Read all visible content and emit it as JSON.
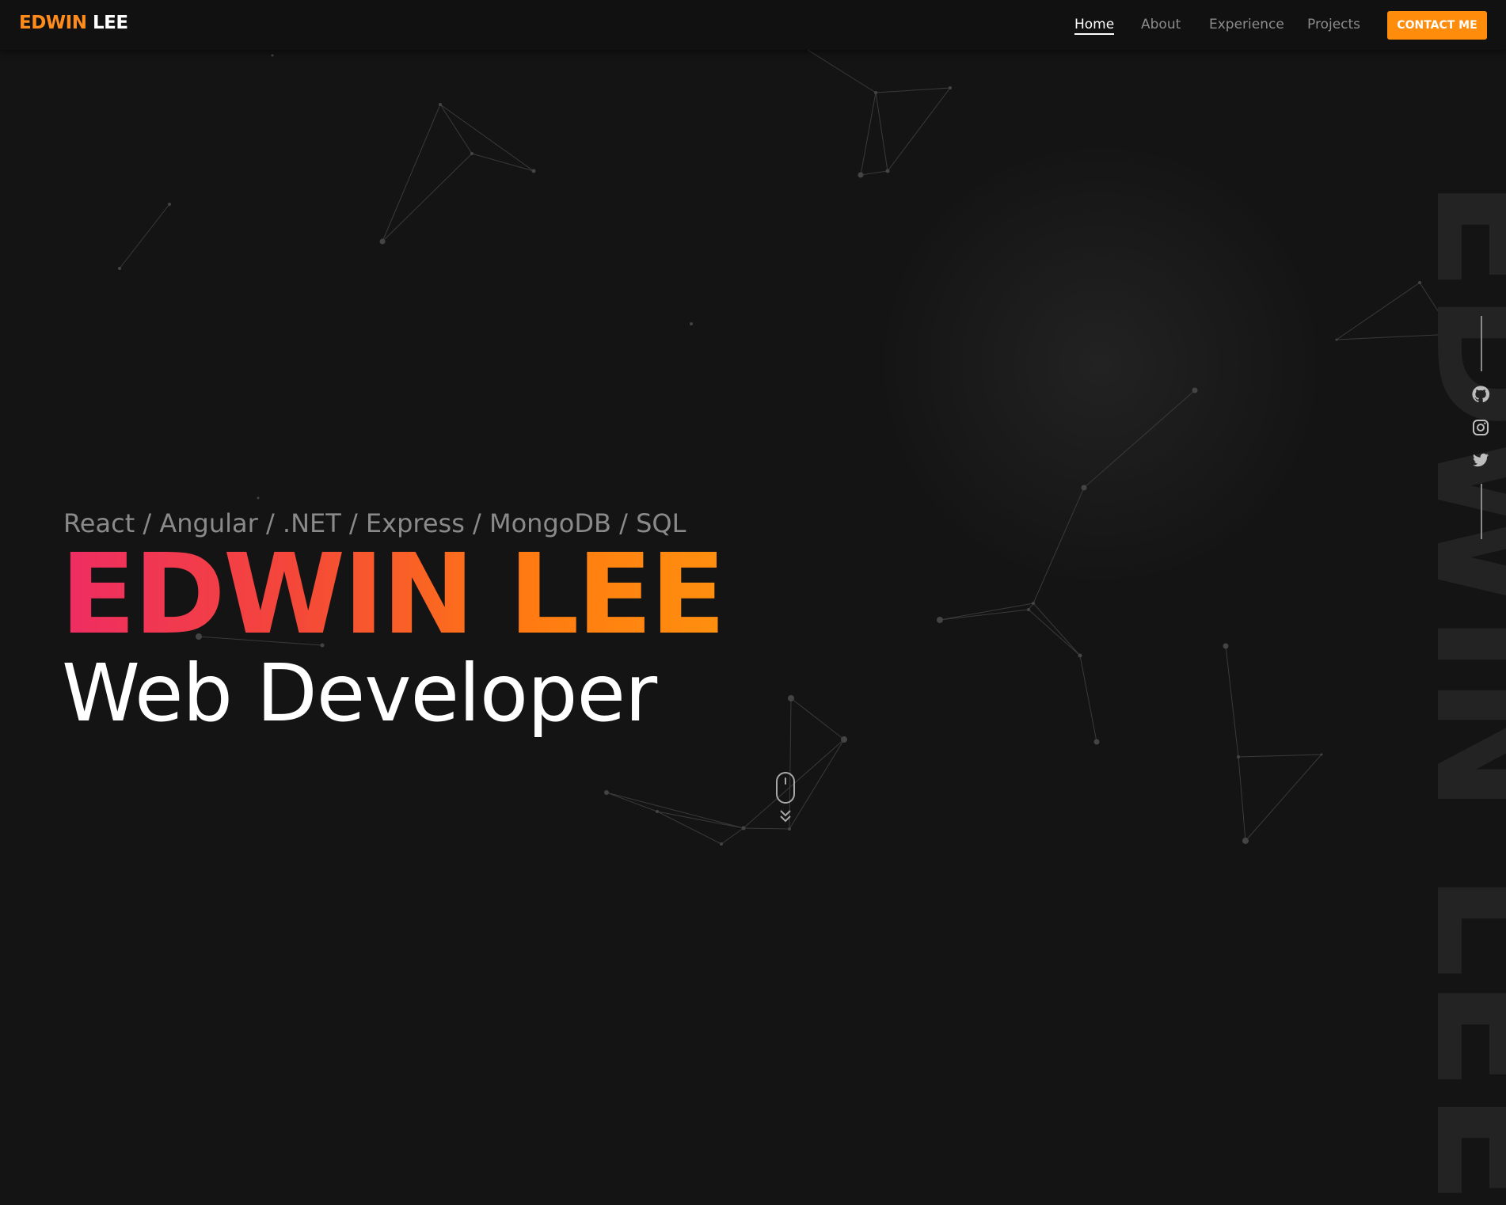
{
  "nav": {
    "logo_first": "EDWIN",
    "logo_last": "LEE",
    "links": [
      {
        "label": "Home",
        "active": true
      },
      {
        "label": "About",
        "active": false
      },
      {
        "label": "Experience",
        "active": false
      },
      {
        "label": "Projects",
        "active": false
      }
    ],
    "contact_label": "CONTACT ME"
  },
  "hero": {
    "stack": "React / Angular / .NET / Express / MongoDB / SQL",
    "name": "EDWIN LEE",
    "role": "Web Developer",
    "vertical_name": "EDWIN LEE"
  },
  "social": {
    "icons": [
      "github-icon",
      "instagram-icon",
      "twitter-icon"
    ]
  },
  "scroll": {
    "icons": [
      "mouse-icon",
      "double-chevron-down-icon"
    ]
  },
  "colors": {
    "accent": "#ff8c0a",
    "gradient_start": "#ee2c63",
    "gradient_end": "#ff8f0e",
    "background": "#141414"
  }
}
